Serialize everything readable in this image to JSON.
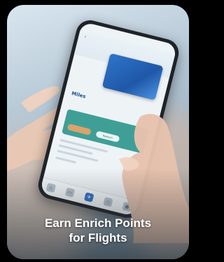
{
  "caption": {
    "line1": "Earn Enrich Points",
    "line2": "for Flights"
  },
  "phone_screen": {
    "balance_value": "Miles",
    "promo_button": "Redeem"
  },
  "colors": {
    "card_blue": "#2f74c9",
    "promo_teal": "#3f9f97",
    "promo_orange": "#d9a36c",
    "caption_text": "#ffffff"
  }
}
